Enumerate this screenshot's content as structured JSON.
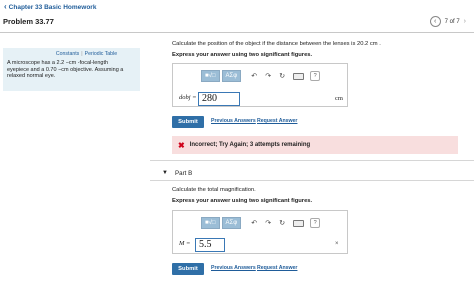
{
  "header": {
    "back_label": "Chapter 33 Basic Homework",
    "problem_title": "Problem 33.77",
    "pager_text": "7 of 7"
  },
  "sidebar": {
    "constants_link": "Constants",
    "periodic_link": "Periodic Table",
    "lines": [
      "A microscope has a 2.2 −cm -focal-length",
      "eyepiece and a 0.70 −cm objective. Assuming a",
      "relaxed normal eye."
    ]
  },
  "part_a": {
    "question": "Calculate the position of the object if the distance between the lenses is 20.2 cm .",
    "instruction": "Express your answer using two significant figures.",
    "variable": "dobj =",
    "value": "280",
    "unit": "cm",
    "submit": "Submit",
    "previous_answers": "Previous Answers",
    "request_answer": "Request Answer",
    "feedback": "Incorrect; Try Again; 3 attempts remaining"
  },
  "part_b": {
    "label": "Part B",
    "question": "Calculate the total magnification.",
    "instruction": "Express your answer using two significant figures.",
    "variable": "M =",
    "value": "5.5",
    "submit": "Submit",
    "previous_answers": "Previous Answers",
    "request_answer": "Request Answer"
  },
  "toolbar": {
    "templates": "■√□",
    "greek": "AΣφ",
    "undo": "↶",
    "redo": "↷",
    "reset": "↻",
    "help": "?"
  },
  "colors": {
    "accent": "#2f6fa7",
    "link": "#1f5c99",
    "error_bg": "#f8dede",
    "error_icon": "#d0021b",
    "sidebar_bg": "#e6f1f6"
  }
}
